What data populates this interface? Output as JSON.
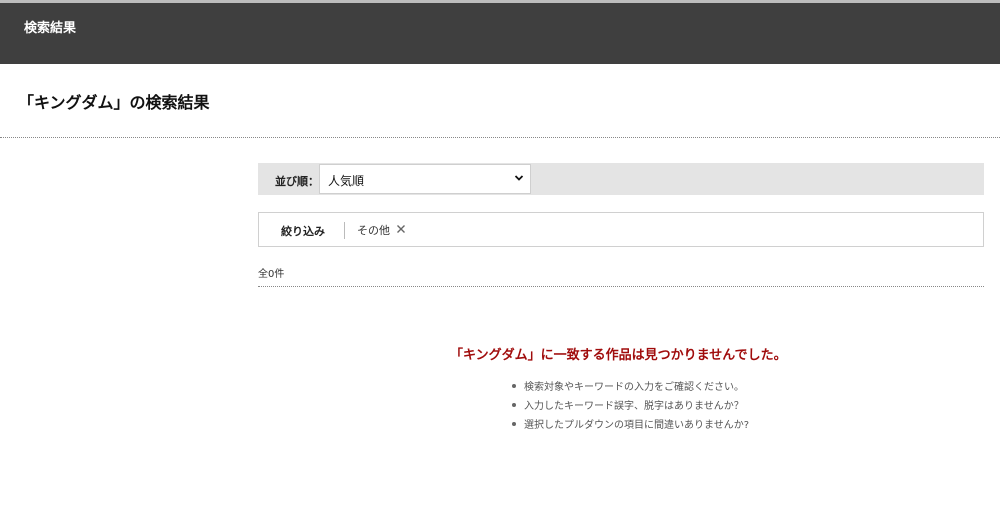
{
  "header": {
    "title": "検索結果"
  },
  "page": {
    "heading": "「キングダム」の検索結果"
  },
  "sort": {
    "label": "並び順：",
    "selected": "人気順"
  },
  "filter": {
    "label": "絞り込み",
    "chip": "その他"
  },
  "results": {
    "count_text": "全0件"
  },
  "empty": {
    "title": "「キングダム」に一致する作品は見つかりませんでした。",
    "hints": [
      "検索対象やキーワードの入力をご確認ください。",
      "入力したキーワード誤字、脱字はありませんか？",
      "選択したプルダウンの項目に間違いありませんか?"
    ]
  },
  "colors": {
    "header_bg": "#3f3f3f",
    "alert_red": "#a00c0c",
    "sort_bar_bg": "#e4e4e4"
  },
  "icons": {
    "select_arrow": "chevron-down-icon",
    "remove": "close-icon"
  }
}
